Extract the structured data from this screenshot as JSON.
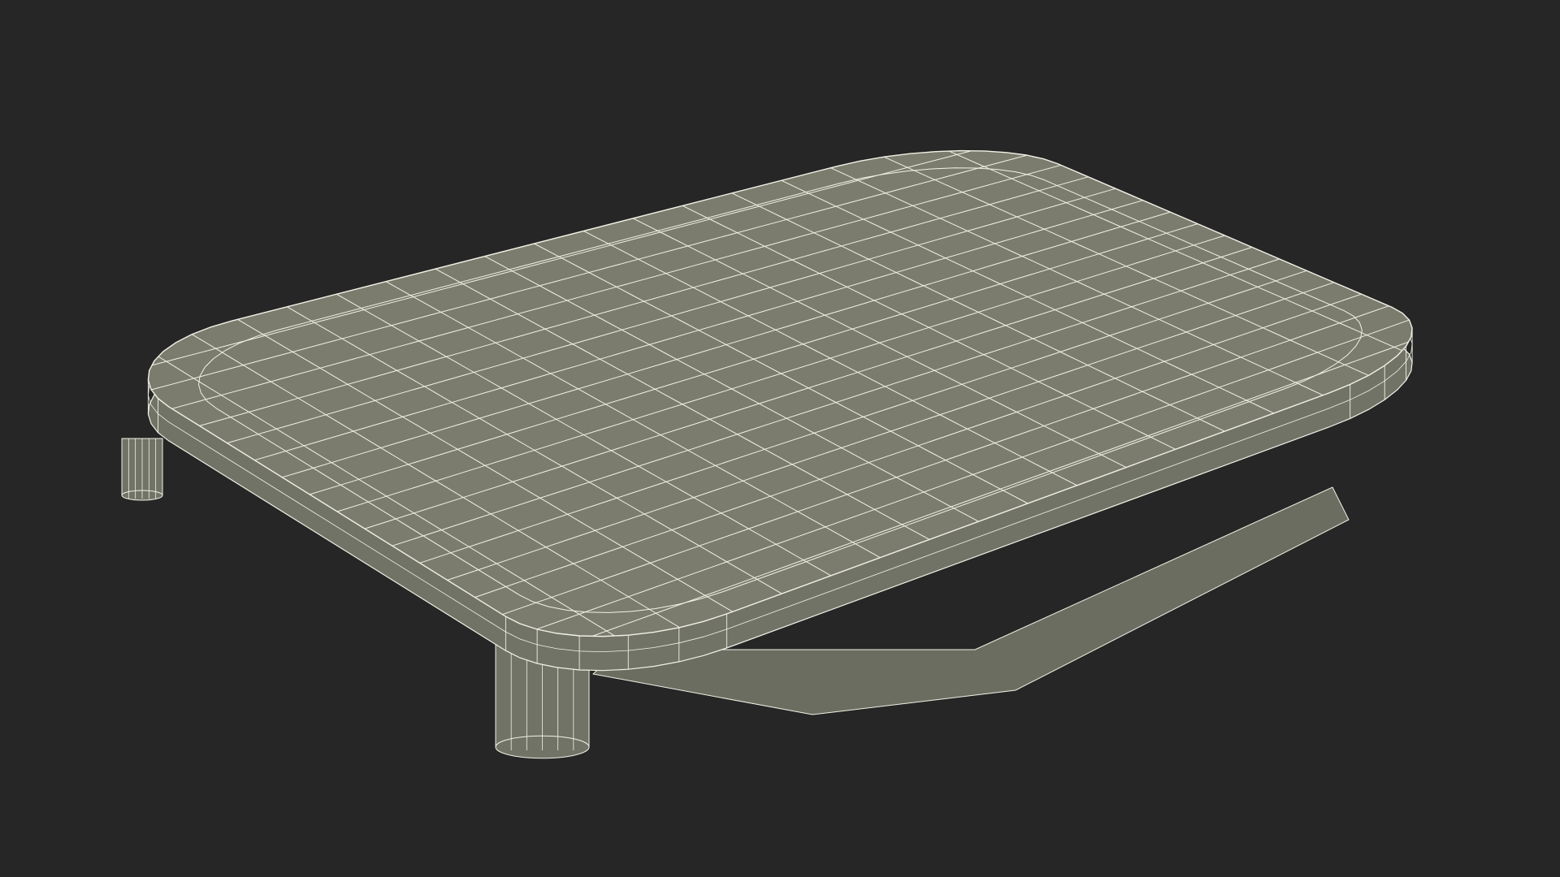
{
  "scene": {
    "background_color": "#262626",
    "surface_color": "#7b7c6e",
    "side_color": "#727367",
    "bottom_color": "#6c6d61",
    "wire_color": "#f2f1e6",
    "shadow_color": "#1f1f1f"
  }
}
